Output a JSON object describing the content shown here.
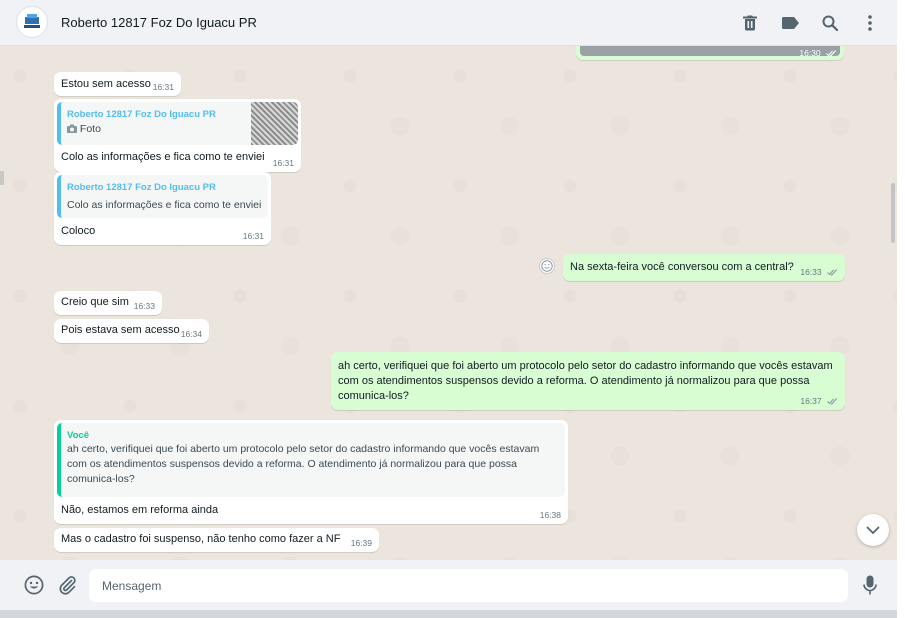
{
  "header": {
    "contact_name": "Roberto 12817 Foz Do Iguacu PR",
    "icons": [
      "delete-icon",
      "label-icon",
      "search-icon",
      "menu-icon"
    ]
  },
  "messages": [
    {
      "dir": "out",
      "text": "",
      "time": "16:30",
      "status": "read",
      "partial": true
    },
    {
      "dir": "in",
      "text": "Estou sem acesso",
      "time": "16:31"
    },
    {
      "dir": "in",
      "quote_author": "Roberto 12817 Foz Do Iguacu PR",
      "quote_text": "Foto",
      "text": "Colo as informações e fica como te enviei",
      "time": "16:31"
    },
    {
      "dir": "in",
      "quote_author": "Roberto 12817 Foz Do Iguacu PR",
      "quote_text": "Colo as informações e fica como te enviei",
      "text": "Coloco",
      "time": "16:31"
    },
    {
      "dir": "out",
      "text": "Na sexta-feira você conversou com a central?",
      "time": "16:33",
      "status": "read"
    },
    {
      "dir": "in",
      "text": "Creio que sim",
      "time": "16:33"
    },
    {
      "dir": "in",
      "text": "Pois estava sem acesso",
      "time": "16:34"
    },
    {
      "dir": "out",
      "text": "ah certo, verifiquei que foi aberto um protocolo pelo setor do cadastro informando que vocês estavam com os atendimentos suspensos devido a reforma. O atendimento já normalizou para que possa comunica-los?",
      "time": "16:37",
      "status": "read"
    },
    {
      "dir": "in",
      "quote_author": "Você",
      "quote_text": "ah certo, verifiquei que foi aberto um protocolo pelo setor do cadastro informando que vocês estavam com os atendimentos suspensos devido a reforma. O atendimento já normalizou para que possa comunica-los?",
      "text": "Não, estamos em reforma ainda",
      "time": "16:38"
    },
    {
      "dir": "in",
      "text": "Mas o cadastro foi suspenso, não tenho como fazer a NF",
      "time": "16:39"
    }
  ],
  "composer": {
    "placeholder": "Mensagem",
    "icons": [
      "emoji-icon",
      "attach-icon",
      "mic-icon"
    ]
  },
  "colors": {
    "incoming_bubble": "#ffffff",
    "outgoing_bubble": "#d9fdd3",
    "quote_bar_contact": "#53bdeb",
    "quote_bar_self": "#06cf9c",
    "chat_background": "#ece5dd"
  }
}
